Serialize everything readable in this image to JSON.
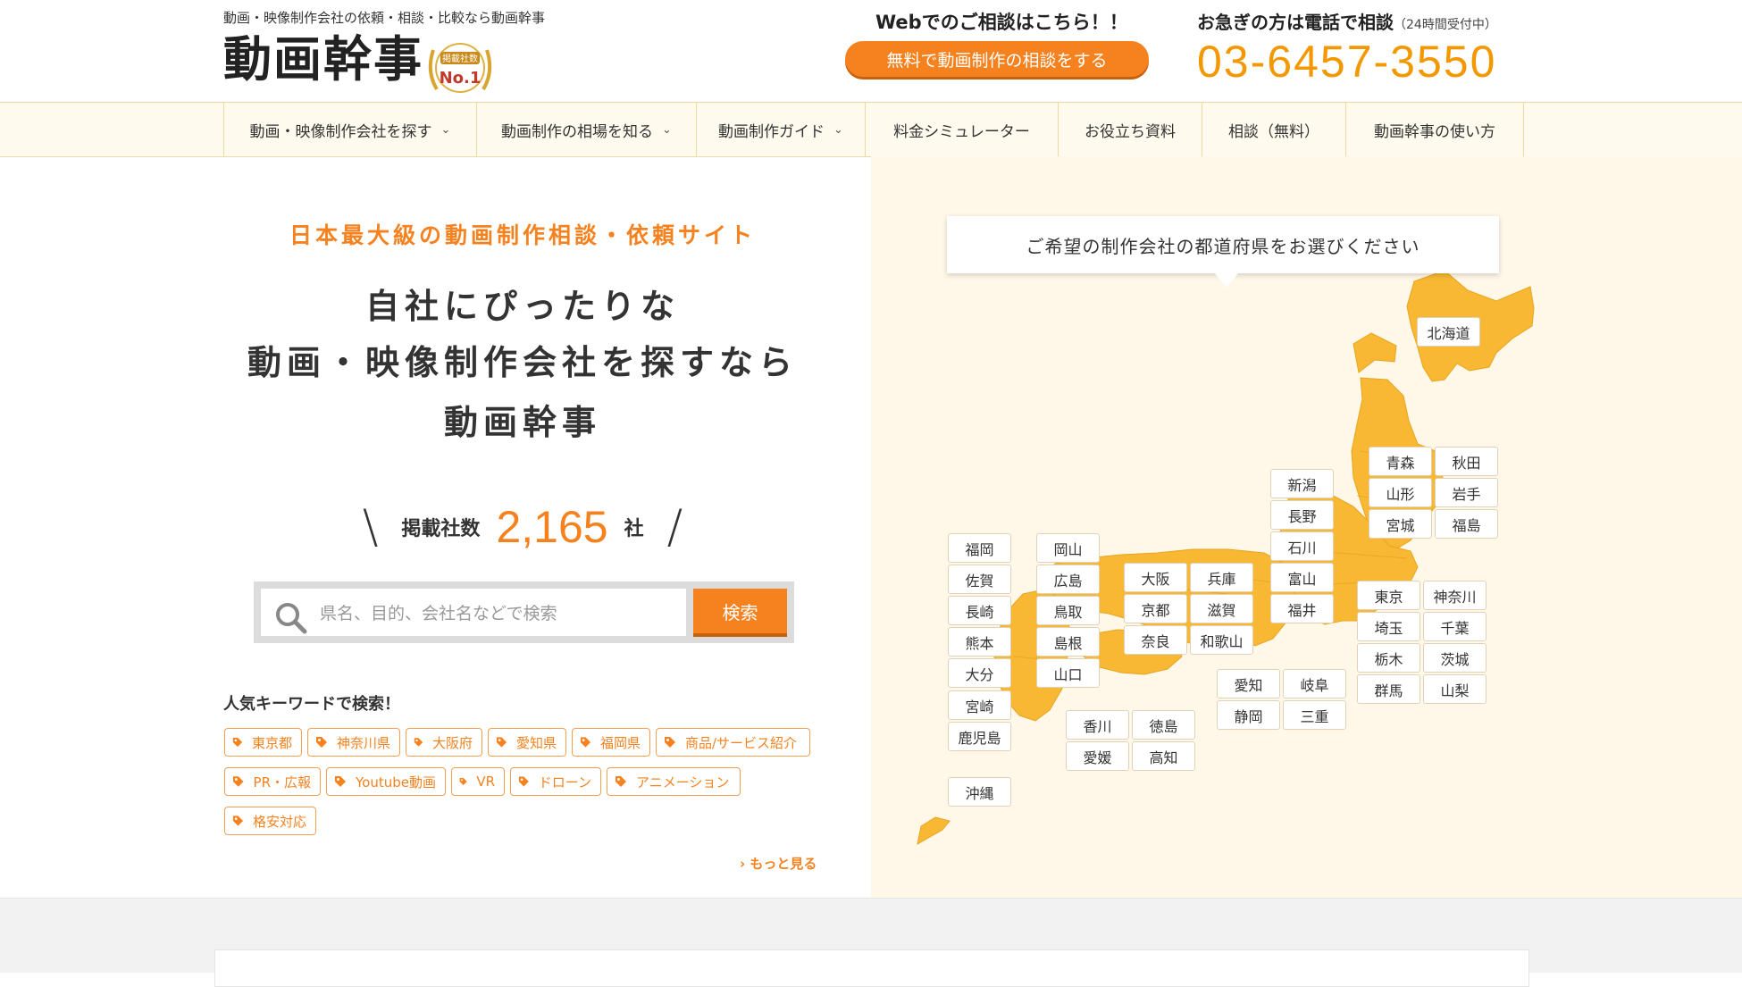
{
  "header": {
    "tagline": "動画・映像制作会社の依頼・相談・比較なら動画幹事",
    "logo_text": "動画幹事",
    "badge_line1": "掲載社数",
    "badge_line2": "No.1",
    "web_cta_label": "Webでのご相談はこちら！！",
    "web_cta_button": "無料で動画制作の相談をする",
    "tel_label": "お急ぎの方は電話で相談",
    "tel_note": "（24時間受付中）",
    "tel_number": "03-6457-3550"
  },
  "nav": {
    "items": [
      {
        "label": "動画・映像制作会社を探す",
        "dropdown": true
      },
      {
        "label": "動画制作の相場を知る",
        "dropdown": true
      },
      {
        "label": "動画制作ガイド",
        "dropdown": true
      },
      {
        "label": "料金シミュレーター",
        "dropdown": false
      },
      {
        "label": "お役立ち資料",
        "dropdown": false
      },
      {
        "label": "相談（無料）",
        "dropdown": false
      },
      {
        "label": "動画幹事の使い方",
        "dropdown": false
      }
    ]
  },
  "hero": {
    "lead": "日本最大級の動画制作相談・依頼サイト",
    "headline_line1": "自社にぴったりな",
    "headline_line2": "動画・映像制作会社を探すなら",
    "headline_line3": "動画幹事",
    "count_label": "掲載社数",
    "count_value": "2,165",
    "count_unit": "社"
  },
  "search": {
    "placeholder": "県名、目的、会社名などで検索",
    "button_label": "検索"
  },
  "keywords": {
    "title": "人気キーワードで検索！",
    "tags": [
      "東京都",
      "神奈川県",
      "大阪府",
      "愛知県",
      "福岡県",
      "商品/サービス紹介",
      "PR・広報",
      "Youtube動画",
      "VR",
      "ドローン",
      "アニメーション",
      "格安対応"
    ],
    "more_label": "もっと見る"
  },
  "map": {
    "prompt": "ご希望の制作会社の都道府県をお選びください",
    "prefectures": {
      "hokkaido": "北海道",
      "aomori": "青森",
      "akita": "秋田",
      "yamagata": "山形",
      "iwate": "岩手",
      "miyagi": "宮城",
      "fukushima": "福島",
      "niigata": "新潟",
      "nagano": "長野",
      "ishikawa": "石川",
      "toyama": "富山",
      "fukui": "福井",
      "tokyo": "東京",
      "kanagawa": "神奈川",
      "saitama": "埼玉",
      "chiba": "千葉",
      "tochigi": "栃木",
      "ibaraki": "茨城",
      "gunma": "群馬",
      "yamanashi": "山梨",
      "aichi": "愛知",
      "gifu": "岐阜",
      "shizuoka": "静岡",
      "mie": "三重",
      "osaka": "大阪",
      "hyogo": "兵庫",
      "kyoto": "京都",
      "shiga": "滋賀",
      "nara": "奈良",
      "wakayama": "和歌山",
      "okayama": "岡山",
      "hiroshima": "広島",
      "tottori": "鳥取",
      "shimane": "島根",
      "yamaguchi": "山口",
      "kagawa": "香川",
      "tokushima": "徳島",
      "ehime": "愛媛",
      "kochi": "高知",
      "fukuoka": "福岡",
      "saga": "佐賀",
      "nagasaki": "長崎",
      "kumamoto": "熊本",
      "oita": "大分",
      "miyazaki": "宮崎",
      "kagoshima": "鹿児島",
      "okinawa": "沖縄"
    }
  },
  "colors": {
    "accent": "#f5821f",
    "accent_yellow": "#f39800",
    "map_fill": "#f8b833",
    "nav_bg": "#fffaee",
    "map_bg": "#fff8e8"
  }
}
